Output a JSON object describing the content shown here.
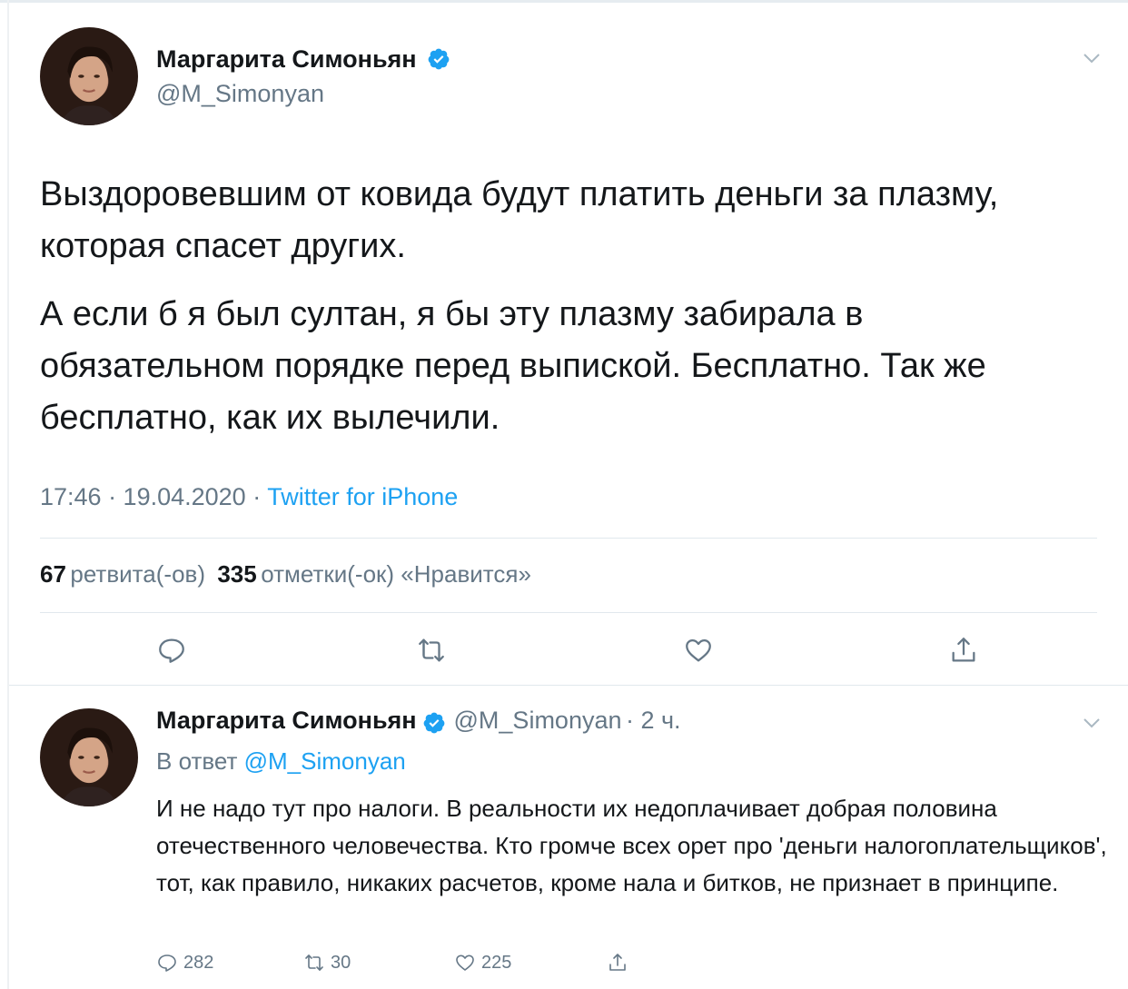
{
  "main_tweet": {
    "author_name": "Маргарита Симоньян",
    "author_handle": "@M_Simonyan",
    "paragraph1": "Выздоровевшим от ковида будут платить деньги за плазму, которая спасет других.",
    "paragraph2": "А если б я был султан, я бы эту плазму забирала в обязательном порядке перед выпиской. Бесплатно. Так же бесплатно, как их вылечили.",
    "timestamp": "17:46 · 19.04.2020 · ",
    "source": "Twitter for iPhone",
    "retweets_count": "67",
    "retweets_label": "ретвита(-ов)",
    "likes_count": "335",
    "likes_label": "отметки(-ок) «Нравится»"
  },
  "reply_tweet": {
    "author_name": "Маргарита Симоньян",
    "author_handle": "@M_Simonyan",
    "time": "· 2 ч.",
    "reply_prefix": "В ответ",
    "reply_mention": "@M_Simonyan",
    "text": "И не надо тут про налоги. В реальности их недоплачивает добрая половина отечественного человечества. Кто громче всех орет про 'деньги налогоплательщиков', тот, как правило, никаких расчетов, кроме нала и битков, не признает в принципе.",
    "replies": "282",
    "retweets": "30",
    "likes": "225"
  },
  "icons": {
    "verified": "verified-badge-icon",
    "reply": "reply-icon",
    "retweet": "retweet-icon",
    "like": "heart-icon",
    "share": "share-icon",
    "more": "chevron-down-icon"
  },
  "colors": {
    "accent": "#1da1f2",
    "secondary_text": "#657786",
    "divider": "#e1e8ed"
  }
}
